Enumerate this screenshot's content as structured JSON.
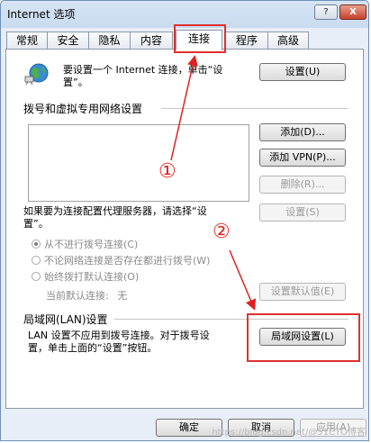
{
  "window": {
    "title": "Internet 选项",
    "help_label": "?",
    "close_label": "X"
  },
  "tabs": [
    "常规",
    "安全",
    "隐私",
    "内容",
    "连接",
    "程序",
    "高级"
  ],
  "setup": {
    "text_line1": "要设置一个 Internet 连接，单击“设",
    "text_line2": "置”。",
    "button": "设置(U)"
  },
  "dialup_vpn": {
    "header": "拨号和虚拟专用网络设置",
    "add_button": "添加(D)...",
    "add_vpn_button": "添加 VPN(P)...",
    "remove_button": "删除(R)...",
    "proxy_text_line1": "如果要为连接配置代理服务器，请选择“设",
    "proxy_text_line2": "置”。",
    "settings_button": "设置(S)",
    "radio_options": [
      "从不进行拨号连接(C)",
      "不论网络连接是否存在都进行拨号(W)",
      "始终拨打默认连接(O)"
    ],
    "current_default_label": "当前默认连接:",
    "current_default_value": "无",
    "set_default_button": "设置默认值(E)"
  },
  "lan": {
    "header": "局域网(LAN)设置",
    "text_line1": "LAN 设置不应用到拨号连接。对于拨号设",
    "text_line2": "置，单击上面的“设置”按钮。",
    "button": "局域网设置(L)"
  },
  "footer": {
    "ok": "确定",
    "cancel": "取消",
    "apply": "应用(A)"
  },
  "annotations": {
    "one": "①",
    "two": "②"
  },
  "watermark": "https://blog.csdn.net/@51CTO博客",
  "colors": {
    "annotation": "#e02020"
  }
}
